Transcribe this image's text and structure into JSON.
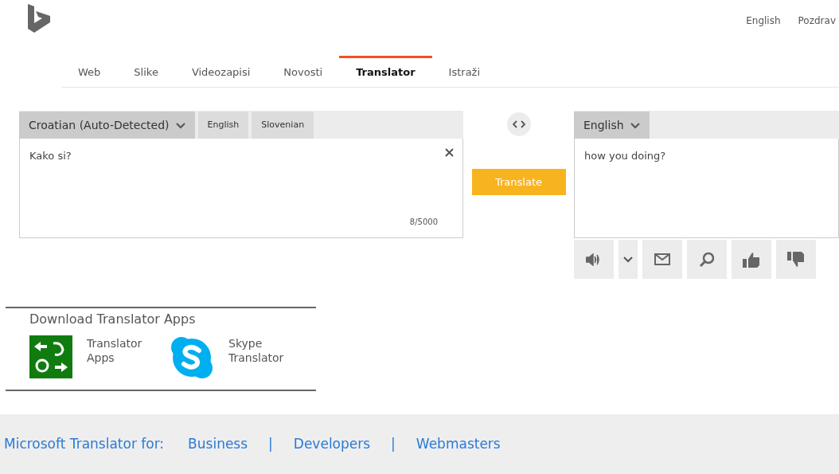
{
  "header": {
    "top_links": [
      "English",
      "Pozdrav"
    ]
  },
  "nav_tabs": [
    {
      "label": "Web",
      "selected": false
    },
    {
      "label": "Slike",
      "selected": false
    },
    {
      "label": "Videozapisi",
      "selected": false
    },
    {
      "label": "Novosti",
      "selected": false
    },
    {
      "label": "Translator",
      "selected": true
    },
    {
      "label": "Istraži",
      "selected": false
    }
  ],
  "source": {
    "languages": [
      {
        "label": "Croatian (Auto-Detected)",
        "kind": "dropdown",
        "selected": true
      },
      {
        "label": "English",
        "kind": "tab",
        "selected": false
      },
      {
        "label": "Slovenian",
        "kind": "tab",
        "selected": false
      }
    ],
    "text": "Kako si?",
    "counter": "8/5000"
  },
  "translate_button": "Translate",
  "target": {
    "language": "English",
    "text": "how you doing?"
  },
  "actions": [
    {
      "kind": "speaker"
    },
    {
      "kind": "dropdown"
    },
    {
      "kind": "mail"
    },
    {
      "kind": "search"
    },
    {
      "kind": "thumbs-up"
    },
    {
      "kind": "thumbs-down"
    }
  ],
  "download": {
    "title": "Download Translator Apps",
    "apps": [
      {
        "kind": "translator",
        "label": "Translator Apps"
      },
      {
        "kind": "skype",
        "label": "Skype Translator"
      }
    ]
  },
  "footer": {
    "label": "Microsoft Translator for:",
    "items": [
      {
        "kind": "link",
        "text": "Business"
      },
      {
        "kind": "separator",
        "text": "|"
      },
      {
        "kind": "link",
        "text": "Developers"
      },
      {
        "kind": "separator",
        "text": "|"
      },
      {
        "kind": "link",
        "text": "Webmasters"
      }
    ]
  }
}
